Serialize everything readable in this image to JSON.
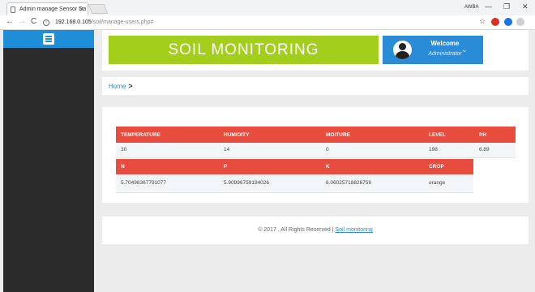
{
  "browser": {
    "tab_title": "Admin manage Sensor Da",
    "tab_close": "✕",
    "url_host": "192.168.0.105",
    "url_path": "/soil/manage-users.php#",
    "user_badge": "AWBA",
    "back": "←",
    "forward": "→",
    "reload": "C",
    "star": "☆",
    "minimize": "—",
    "maximize": "❐",
    "close": "✕"
  },
  "header": {
    "brand": "SOIL MONITORING",
    "welcome_title": "Welcome",
    "welcome_user": "Administrator",
    "caret": "⌄"
  },
  "breadcrumb": {
    "home": "Home",
    "separator": ">"
  },
  "table1": {
    "headers": [
      "TEMPERATURE",
      "HUMIDITY",
      "MOITURE",
      "LEVEL",
      "PH"
    ],
    "row": [
      "30",
      "14",
      "0",
      "198",
      "6.89"
    ]
  },
  "table2": {
    "headers": [
      "N",
      "P",
      "K",
      "CROP"
    ],
    "row": [
      "5.70498367791077",
      "5.90996759194026",
      "6.06025718826759",
      "orange"
    ]
  },
  "footer": {
    "text": "© 2017 . All Rights Reserved | ",
    "link": "Soil monitoring"
  },
  "colors": {
    "brand": "#a3cf1c",
    "welcome": "#2a8bd6",
    "table_header": "#e84c3d",
    "sidebar": "#2b2b2b"
  }
}
